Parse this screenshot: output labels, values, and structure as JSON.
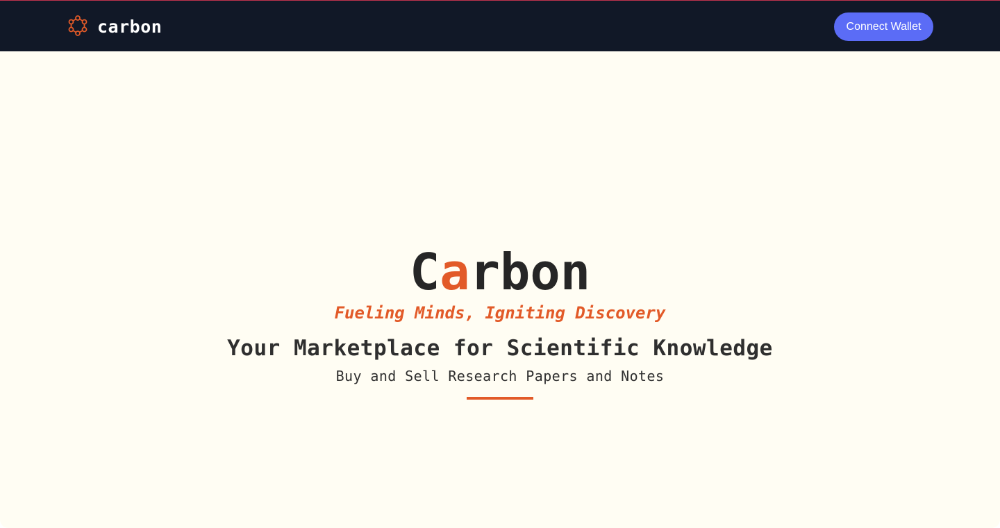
{
  "navbar": {
    "brand_name": "carbon",
    "brand_icon": "molecule-icon",
    "connect_label": "Connect Wallet"
  },
  "hero": {
    "title_start": "C",
    "title_accent": "a",
    "title_end": "rbon",
    "tagline": "Fueling Minds, Igniting Discovery",
    "headline": "Your Marketplace for Scientific Knowledge",
    "subheadline": "Buy and Sell Research Papers and Notes"
  },
  "colors": {
    "navbar_bg": "#111827",
    "page_bg": "#fffdf3",
    "accent": "#e25a28",
    "button_bg": "#5b6cf6",
    "text": "#262626"
  }
}
